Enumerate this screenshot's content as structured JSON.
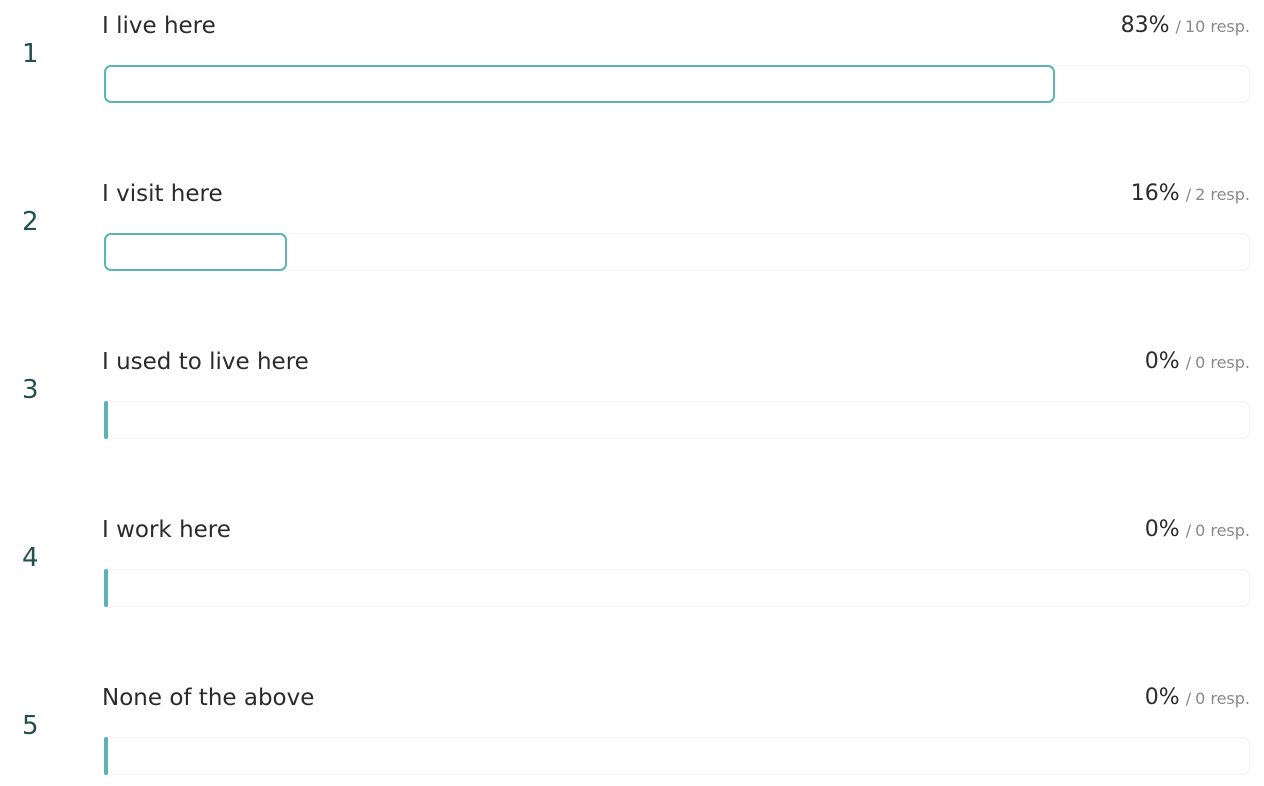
{
  "chart_data": {
    "type": "bar",
    "orientation": "horizontal",
    "categories": [
      "I live here",
      "I visit here",
      "I used to live here",
      "I work here",
      "None of the above"
    ],
    "ranks": [
      "1",
      "2",
      "3",
      "4",
      "5"
    ],
    "values": [
      83,
      16,
      0,
      0,
      0
    ],
    "value_labels": [
      "83%",
      "16%",
      "0%",
      "0%",
      "0%"
    ],
    "responses": [
      "10 resp.",
      "2 resp.",
      "0 resp.",
      "0 resp.",
      "0 resp."
    ],
    "separator": "/",
    "xlim": [
      0,
      100
    ],
    "grid": false,
    "legend": "none",
    "colors": {
      "bar_outline": "#5bb3b3",
      "track_border": "#eef3f5",
      "rank_text": "#24504f",
      "label_text": "#2b2b2b",
      "muted_text": "#8a8a8a"
    }
  }
}
